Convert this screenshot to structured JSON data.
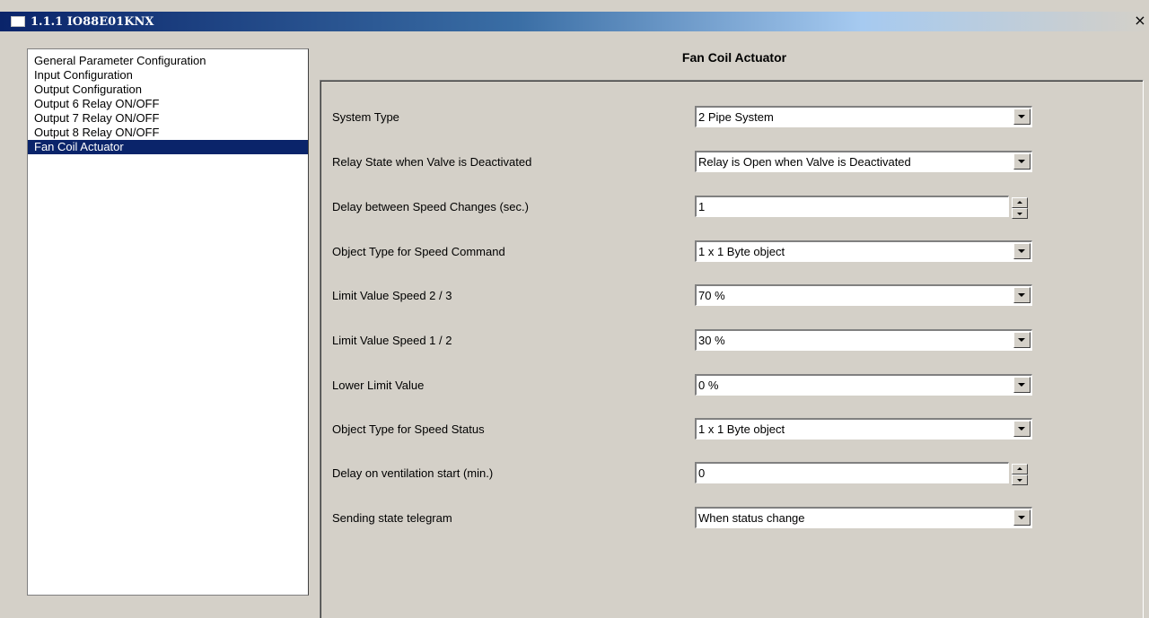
{
  "window": {
    "title": "1.1.1 IO88E01KNX",
    "close_glyph": "×"
  },
  "nav": {
    "items": [
      {
        "label": "General Parameter Configuration",
        "selected": false
      },
      {
        "label": "Input Configuration",
        "selected": false
      },
      {
        "label": "Output Configuration",
        "selected": false
      },
      {
        "label": "Output 6 Relay ON/OFF",
        "selected": false
      },
      {
        "label": "Output 7 Relay ON/OFF",
        "selected": false
      },
      {
        "label": "Output 8 Relay ON/OFF",
        "selected": false
      },
      {
        "label": "Fan Coil Actuator",
        "selected": true
      }
    ]
  },
  "panel": {
    "title": "Fan Coil Actuator",
    "params": [
      {
        "label": "System Type",
        "value": "2 Pipe System",
        "control": "dropdown"
      },
      {
        "label": "Relay State when Valve is Deactivated",
        "value": "Relay is Open when Valve is Deactivated",
        "control": "dropdown"
      },
      {
        "label": "Delay between Speed Changes (sec.)",
        "value": "1",
        "control": "spinner"
      },
      {
        "label": "Object Type for Speed Command",
        "value": "1 x 1 Byte object",
        "control": "dropdown"
      },
      {
        "label": "Limit Value Speed 2 / 3",
        "value": "70 %",
        "control": "dropdown"
      },
      {
        "label": "Limit Value Speed 1 / 2",
        "value": "30 %",
        "control": "dropdown"
      },
      {
        "label": "Lower Limit Value",
        "value": "0 %",
        "control": "dropdown"
      },
      {
        "label": "Object Type for Speed Status",
        "value": "1 x 1 Byte object",
        "control": "dropdown"
      },
      {
        "label": "Delay on ventilation start (min.)",
        "value": "0",
        "control": "spinner"
      },
      {
        "label": "Sending state telegram",
        "value": "When status change",
        "control": "dropdown"
      }
    ]
  }
}
